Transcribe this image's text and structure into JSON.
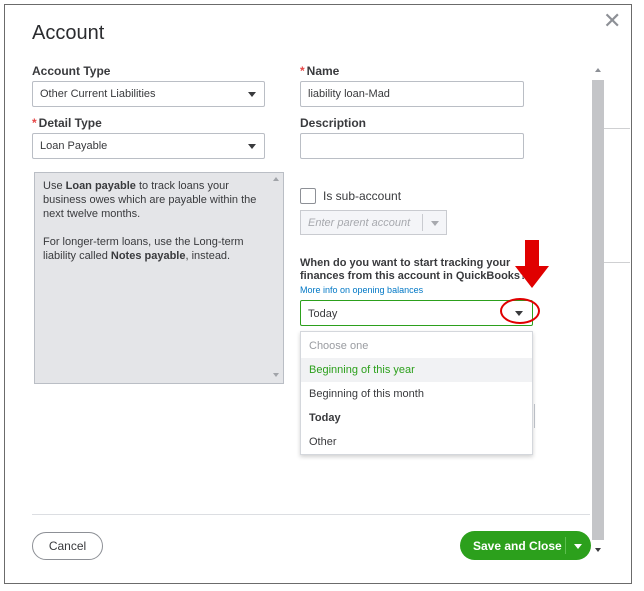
{
  "dialog": {
    "title": "Account",
    "close_icon": "close-icon"
  },
  "account_type": {
    "label": "Account Type",
    "value": "Other Current Liabilities"
  },
  "name": {
    "required_mark": "*",
    "label": "Name",
    "value": "liability loan-Mad"
  },
  "detail_type": {
    "required_mark": "*",
    "label": "Detail Type",
    "value": "Loan Payable"
  },
  "description": {
    "label": "Description",
    "value": ""
  },
  "help": {
    "p1_a": "Use ",
    "p1_b": "Loan payable",
    "p1_c": " to track loans your business owes which are payable within the next twelve months.",
    "p2_a": "For longer-term loans, use the Long-term liability called ",
    "p2_b": "Notes payable",
    "p2_c": ", instead."
  },
  "sub_account": {
    "label": "Is sub-account",
    "checked": false,
    "parent_placeholder": "Enter parent account"
  },
  "opening_balance": {
    "question": "When do you want to start tracking your finances from this account in QuickBooks?",
    "more_info_link": "More info on opening balances",
    "selected": "Today",
    "options": [
      {
        "label": "Choose one",
        "state": "placeholder"
      },
      {
        "label": "Beginning of this year",
        "state": "highlighted"
      },
      {
        "label": "Beginning of this month",
        "state": "normal"
      },
      {
        "label": "Today",
        "state": "selected"
      },
      {
        "label": "Other",
        "state": "normal"
      }
    ]
  },
  "footer": {
    "cancel": "Cancel",
    "save": "Save and Close"
  },
  "colors": {
    "primary_green": "#2ca01c",
    "required_red": "#e64747",
    "link_blue": "#0077c5",
    "annotation_red": "#e00000"
  }
}
